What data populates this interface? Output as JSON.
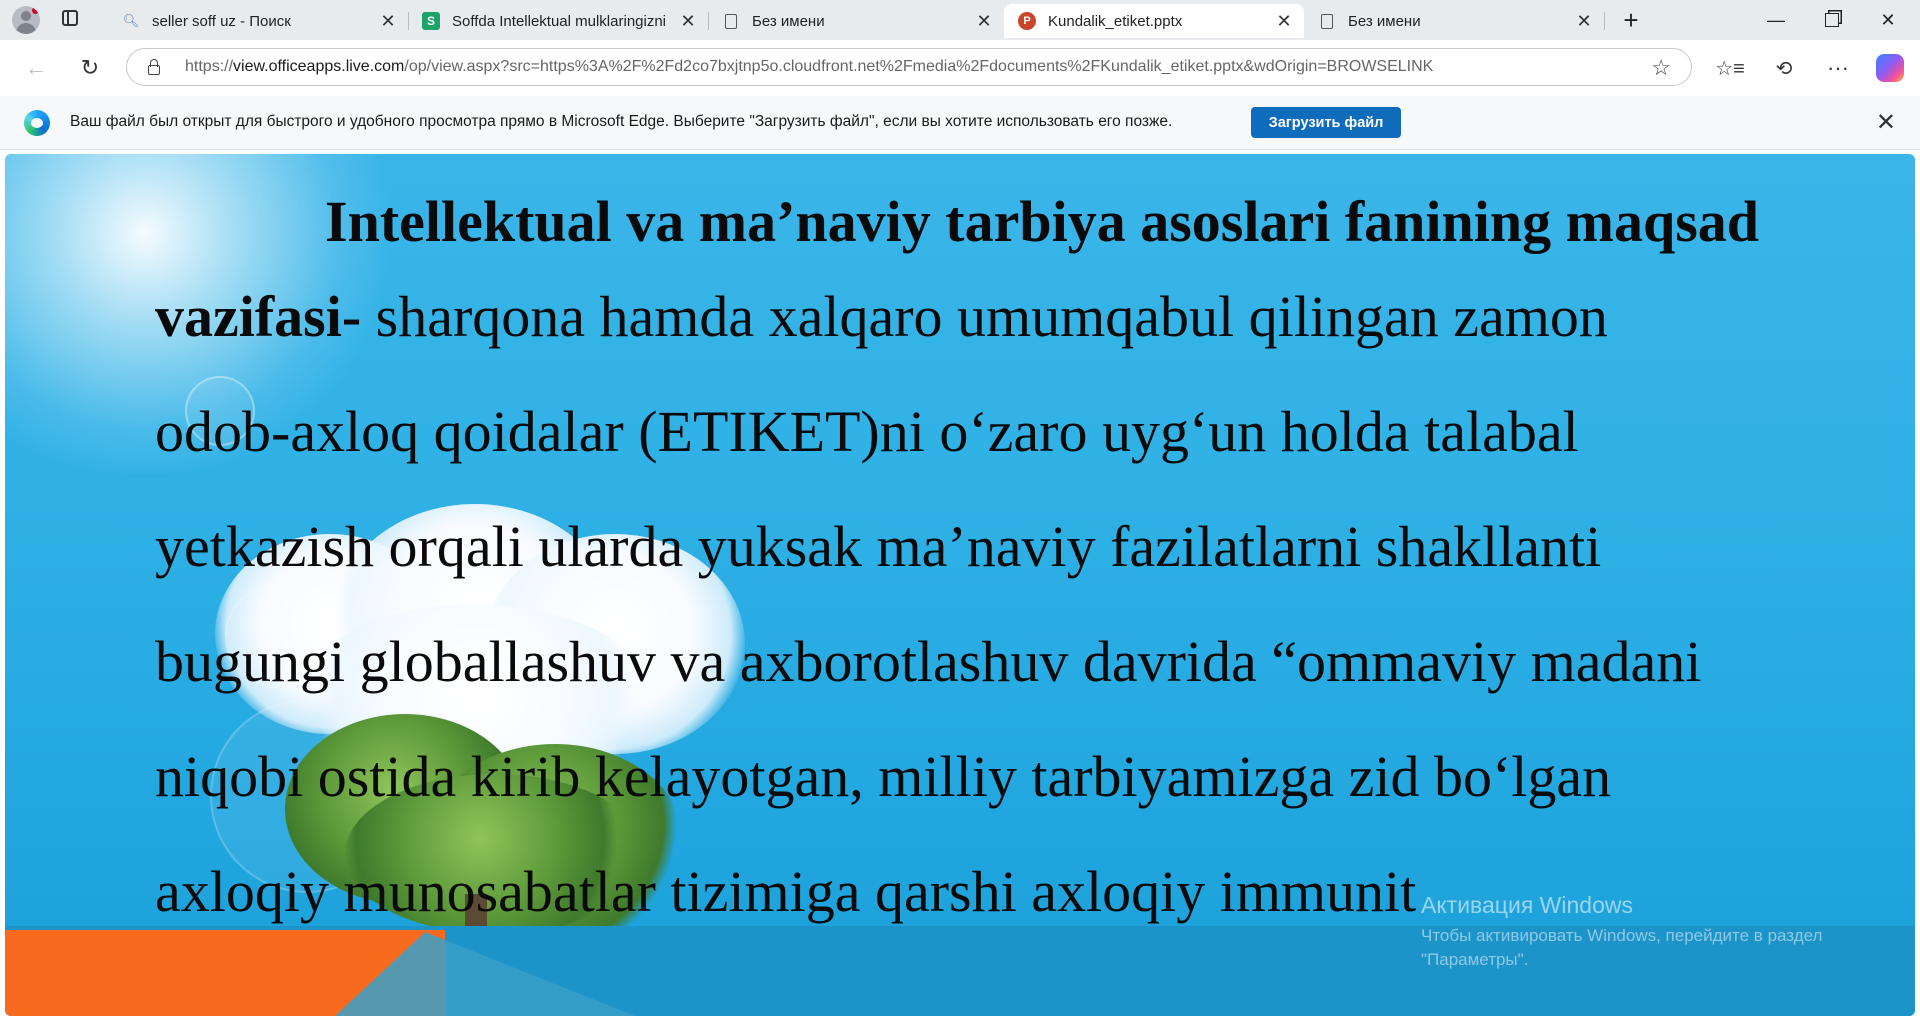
{
  "tabs": [
    {
      "title": "seller soff uz - Поиск",
      "icon": "search-icon"
    },
    {
      "title": "Soffda Intellektual mulklaringizni",
      "icon": "soff-logo-icon"
    },
    {
      "title": "Без имени",
      "icon": "page-icon"
    },
    {
      "title": "Kundalik_etiket.pptx",
      "icon": "powerpoint-icon",
      "active": true
    },
    {
      "title": "Без имени",
      "icon": "page-icon"
    }
  ],
  "address": {
    "url_prefix": "https://",
    "url_domain": "view.officeapps.live.com",
    "url_rest": "/op/view.aspx?src=https%3A%2F%2Fd2co7bxjtnp5o.cloudfront.net%2Fmedia%2Fdocuments%2FKundalik_etiket.pptx&wdOrigin=BROWSELINK"
  },
  "infobar": {
    "message": "Ваш файл был открыт для быстрого и удобного просмотра прямо в Microsoft Edge. Выберите \"Загрузить файл\", если вы хотите использовать его позже.",
    "download_label": "Загрузить файл"
  },
  "slide": {
    "title": "Intellektual va ma’naviy tarbiya asoslari  fanining maqsad",
    "line1_bold": "vazifasi-",
    "line1_rest": " sharqona  hamda  xalqaro  umumqabul  qilingan  zamon",
    "line2": "odob-axloq  qoidalar  (ETIKET)ni  o‘zaro  uyg‘un  holda  talabal",
    "line3": "yetkazish  orqali  ularda  yuksak  ma’naviy  fazilatlarni  shakllanti",
    "line4": "bugungi  globallashuv  va  axborotlashuv  davrida  “ommaviy  madani",
    "line5": "niqobi  ostida  kirib  kelayotgan,  milliy  tarbiyamizga  zid  bo‘lgan",
    "line6": "axloqiy    munosabatlar    tizimiga    qarshi    axloqiy    immunit"
  },
  "watermark": {
    "title": "Активация Windows",
    "subtitle": "Чтобы активировать Windows, перейдите в раздел \"Параметры\"."
  },
  "colors": {
    "accent": "#0f6cbd",
    "slide_bg": "#2fb1e6",
    "orange": "#f86a1e"
  }
}
